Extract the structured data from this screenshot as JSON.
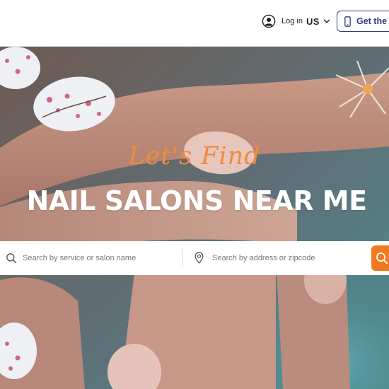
{
  "header": {
    "login_label": "Log in",
    "country_label": "US",
    "get_app_label": "Get the App",
    "accent_color": "#2d3b86"
  },
  "hero": {
    "tagline": "Let's Find",
    "headline": "NAIL SALONS NEAR ME",
    "tagline_color": "#f08a3e"
  },
  "search": {
    "service_placeholder": "Search by service or salon name",
    "location_placeholder": "Search by address or zipcode",
    "button_color": "#f07a1f"
  },
  "icons": {
    "login": "user-circle-icon",
    "country": "chevron-down-icon",
    "app": "phone-icon",
    "service": "search-icon",
    "location": "map-pin-icon",
    "submit": "search-icon"
  }
}
